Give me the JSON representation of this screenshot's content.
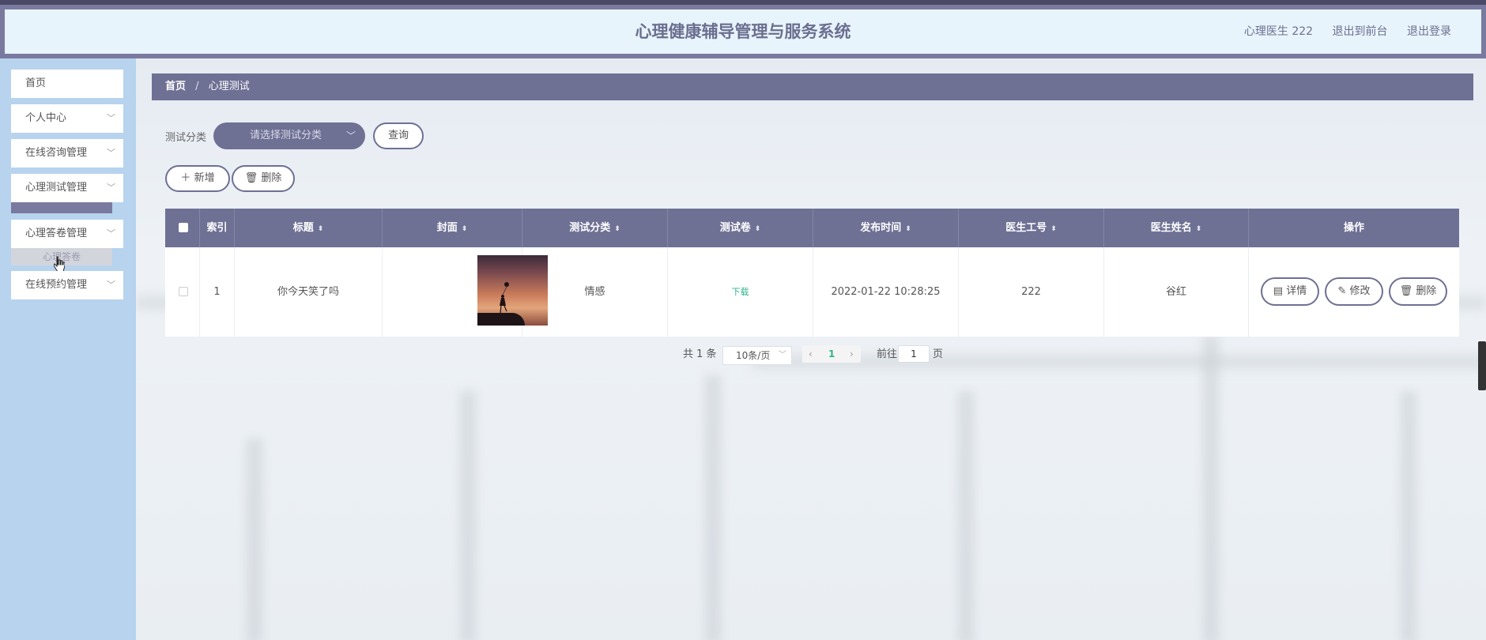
{
  "header": {
    "title": "心理健康辅导管理与服务系统",
    "user": "心理医生 222",
    "back_to_front": "退出到前台",
    "logout": "退出登录"
  },
  "sidebar": {
    "items": [
      {
        "label": "首页"
      },
      {
        "label": "个人中心"
      },
      {
        "label": "在线咨询管理"
      },
      {
        "label": "心理测试管理"
      },
      {
        "label": "心理答卷管理"
      },
      {
        "label": "在线预约管理"
      }
    ],
    "hover_submenu": "心理答卷"
  },
  "breadcrumb": {
    "home": "首页",
    "separator": "/",
    "current": "心理测试"
  },
  "filter": {
    "label": "测试分类",
    "select_placeholder": "请选择测试分类",
    "query_button": "查询"
  },
  "actions": {
    "add": "新增",
    "delete": "删除"
  },
  "table": {
    "headers": [
      "索引",
      "标题",
      "封面",
      "测试分类",
      "测试卷",
      "发布时间",
      "医生工号",
      "医生姓名",
      "操作"
    ],
    "rows": [
      {
        "index": "1",
        "title": "你今天笑了吗",
        "category": "情感",
        "test_paper": "下载",
        "publish_time": "2022-01-22 10:28:25",
        "doctor_id": "222",
        "doctor_name": "谷红",
        "ops": {
          "detail": "详情",
          "edit": "修改",
          "delete": "删除"
        }
      }
    ]
  },
  "pagination": {
    "total": "共 1 条",
    "page_size": "10条/页",
    "current_page": "1",
    "goto_prefix": "前往",
    "goto_value": "1",
    "goto_suffix": "页"
  },
  "colors": {
    "primary": "#6e7094",
    "sidebar_bg": "#b7d3ee",
    "header_bg": "#e8f4fc",
    "link_green": "#2fb38c"
  }
}
